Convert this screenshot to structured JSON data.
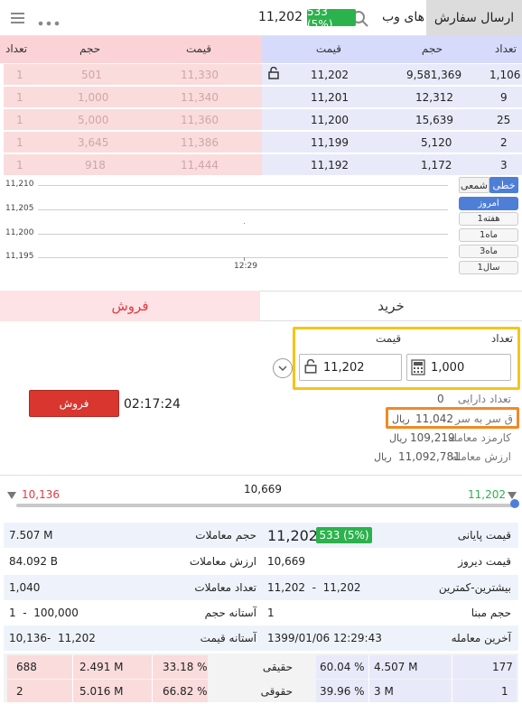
{
  "header": {
    "send_order_label": "ارسال سفارش",
    "stock_name": "های وب",
    "change_badge": "533 (5%)",
    "last_price": "11,202"
  },
  "order_book": {
    "headers": {
      "buy_count": "تعداد",
      "buy_volume": "حجم",
      "buy_price": "قیمت",
      "sell_price": "قیمت",
      "sell_volume": "حجم",
      "sell_count": "تعداد"
    },
    "buy_rows": [
      {
        "count": "1,106",
        "volume": "9,581,369",
        "price": "11,202"
      },
      {
        "count": "9",
        "volume": "12,312",
        "price": "11,201"
      },
      {
        "count": "25",
        "volume": "15,639",
        "price": "11,200"
      },
      {
        "count": "2",
        "volume": "5,120",
        "price": "11,199"
      },
      {
        "count": "3",
        "volume": "1,172",
        "price": "11,192"
      }
    ],
    "sell_rows": [
      {
        "price": "11,330",
        "volume": "501",
        "count": "1"
      },
      {
        "price": "11,340",
        "volume": "1,000",
        "count": "1"
      },
      {
        "price": "11,360",
        "volume": "5,000",
        "count": "1"
      },
      {
        "price": "11,386",
        "volume": "3,645",
        "count": "1"
      },
      {
        "price": "11,444",
        "volume": "918",
        "count": "1"
      }
    ]
  },
  "chart": {
    "y_labels": [
      "11,210",
      "11,205",
      "11,200",
      "11,195"
    ],
    "x_label": "12:29",
    "type_line": "خطی",
    "type_candle": "شمعی",
    "periods": [
      "امروز",
      "1هفته",
      "1ماه",
      "3ماه",
      "1سال"
    ]
  },
  "tabs": {
    "buy": "خرید",
    "sell": "فروش"
  },
  "form": {
    "count_label": "تعداد",
    "price_label": "قیمت",
    "count_value": "1,000",
    "price_value": "11,202",
    "sell_button": "فروش",
    "timer": "02:17:24"
  },
  "info": {
    "assets_label": "تعداد دارایی",
    "assets_value": "0",
    "breakeven_label": "ق سر به سر",
    "breakeven_value": "11,042",
    "commission_label": "کارمزد معامله",
    "commission_value": "109,219",
    "trade_value_label": "ارزش معامله",
    "trade_value_value": "11,092,781",
    "rial": "ریال"
  },
  "slider": {
    "low": "10,136",
    "mid": "10,669",
    "high": "11,202"
  },
  "stats": [
    {
      "r_label": "قیمت پایانی",
      "r_value": "11,202",
      "r_badge": "533 (5%)",
      "l_label": "حجم معاملات",
      "l_value": "7.507 M"
    },
    {
      "r_label": "قیمت دیروز",
      "r_value": "10,669",
      "l_label": "ارزش معاملات",
      "l_value": "84.092 B"
    },
    {
      "r_label": "بیشترین-کمترین",
      "r_value": "11,202  -  11,202",
      "l_label": "تعداد معاملات",
      "l_value": "1,040"
    },
    {
      "r_label": "حجم مبنا",
      "r_value": "1",
      "l_label": "آستانه حجم",
      "l_value": "1  -  100,000"
    },
    {
      "r_label": "آخرین معامله",
      "r_value": "1399/01/06 12:29:43",
      "l_label": "آستانه قیمت",
      "l_value": "10,136-  11,202"
    }
  ],
  "bottom": [
    {
      "label": "حقیقی",
      "buy_count": "177",
      "buy_vol": "4.507 M",
      "buy_pct": "60.04 %",
      "sell_pct": "33.18 %",
      "sell_vol": "2.491 M",
      "sell_count": "688"
    },
    {
      "label": "حقوقی",
      "buy_count": "1",
      "buy_vol": "3 M",
      "buy_pct": "39.96 %",
      "sell_pct": "66.82 %",
      "sell_vol": "5.016 M",
      "sell_count": "2"
    }
  ],
  "colors": {
    "buy_bg": "#e8eaf9",
    "sell_bg": "#fadcdc",
    "accent_green": "#2bb24c",
    "accent_red": "#d8362f",
    "accent_blue": "#4f7ed7"
  }
}
